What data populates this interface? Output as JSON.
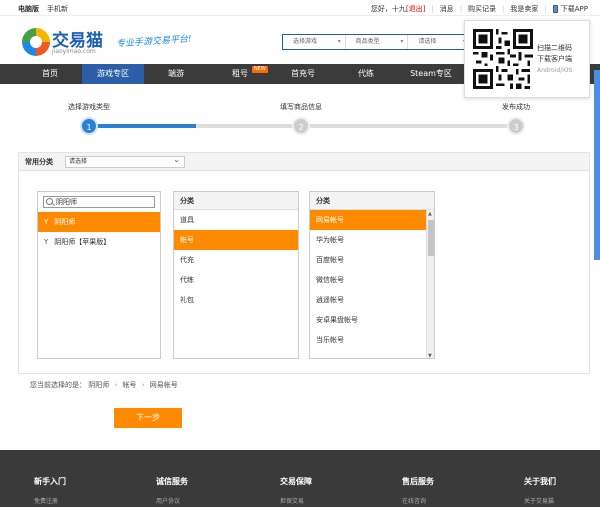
{
  "topbar": {
    "left": [
      "电脑版",
      "手机新"
    ],
    "greeting": "您好，十九",
    "logout": "[退出]",
    "links": [
      "消息",
      "购买记录",
      "我是卖家",
      "下载APP"
    ]
  },
  "header": {
    "logo_text": "交易猫",
    "logo_sub": "jiaoyimao.com",
    "slogan": "专业手游交易平台!",
    "search_selects": [
      "选择游戏",
      "商品类型",
      "请选择"
    ]
  },
  "qr_popup": {
    "line1": "扫描二维码",
    "line2": "下载客户端",
    "line3": "Android/iOS"
  },
  "nav": {
    "items": [
      "首页",
      "游戏专区",
      "端游",
      "租号",
      "首充号",
      "代练",
      "Steam专区"
    ],
    "active_index": 1,
    "badge": "NEW"
  },
  "steps": {
    "labels": [
      "选择游戏类型",
      "填写商品信息",
      "发布成功"
    ],
    "numbers": [
      "1",
      "2",
      "3"
    ],
    "current": 1
  },
  "common": {
    "label": "常用分类",
    "select_value": "请选择"
  },
  "games_col": {
    "search_value": "阴阳师",
    "items": [
      {
        "prefix": "Y",
        "label": "阴阳师",
        "selected": true
      },
      {
        "prefix": "Y",
        "label": "阴阳师【苹果版】",
        "selected": false
      }
    ]
  },
  "category_col": {
    "header": "分类",
    "items": [
      {
        "label": "道具",
        "selected": false
      },
      {
        "label": "帐号",
        "selected": true
      },
      {
        "label": "代充",
        "selected": false
      },
      {
        "label": "代练",
        "selected": false
      },
      {
        "label": "礼包",
        "selected": false
      }
    ]
  },
  "sub_col": {
    "header": "分类",
    "items": [
      {
        "label": "网易帐号",
        "selected": true
      },
      {
        "label": "华为帐号",
        "selected": false
      },
      {
        "label": "百度帐号",
        "selected": false
      },
      {
        "label": "微信帐号",
        "selected": false
      },
      {
        "label": "逍遥帐号",
        "selected": false
      },
      {
        "label": "安卓果盘帐号",
        "selected": false
      },
      {
        "label": "当乐帐号",
        "selected": false
      }
    ]
  },
  "selection_path": {
    "prefix": "您当前选择的是：",
    "parts": [
      "阴阳师",
      "帐号",
      "网易帐号"
    ]
  },
  "next_button": "下一步",
  "footer": {
    "columns": [
      {
        "title": "新手入门",
        "link": "免费注册"
      },
      {
        "title": "诚信服务",
        "link": "用户协议"
      },
      {
        "title": "交易保障",
        "link": "担保交易"
      },
      {
        "title": "售后服务",
        "link": "在线咨询"
      },
      {
        "title": "关于我们",
        "link": "关于交易猫"
      }
    ]
  },
  "colors": {
    "primary_blue": "#2c5fa8",
    "accent_orange": "#ff8a00",
    "nav_bg": "#3b3b3b",
    "footer_bg": "#3a3a3a"
  }
}
